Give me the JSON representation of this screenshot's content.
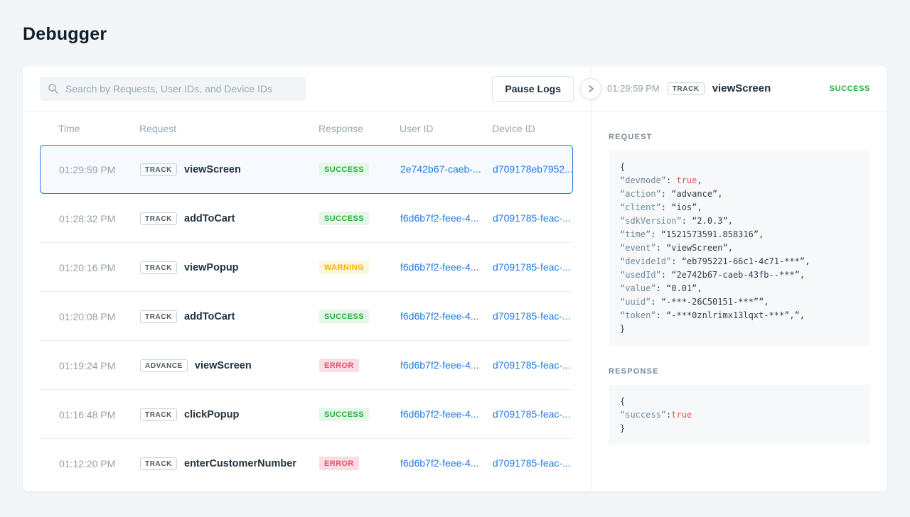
{
  "page": {
    "title": "Debugger"
  },
  "toolbar": {
    "search_placeholder": "Search by Requests, User IDs, and Device IDs",
    "pause_logs_label": "Pause Logs"
  },
  "table": {
    "columns": {
      "time": "Time",
      "request": "Request",
      "response": "Response",
      "user_id": "User ID",
      "device_id": "Device ID"
    },
    "rows": [
      {
        "time": "01:29:59 PM",
        "type": "TRACK",
        "request": "viewScreen",
        "response": "SUCCESS",
        "user_id": "2e742b67-caeb-...",
        "device_id": "d709178eb7952...",
        "selected": true
      },
      {
        "time": "01:28:32 PM",
        "type": "TRACK",
        "request": "addToCart",
        "response": "SUCCESS",
        "user_id": "f6d6b7f2-feee-4...",
        "device_id": "d7091785-feac-...",
        "selected": false
      },
      {
        "time": "01:20:16 PM",
        "type": "TRACK",
        "request": "viewPopup",
        "response": "WARNING",
        "user_id": "f6d6b7f2-feee-4...",
        "device_id": "d7091785-feac-...",
        "selected": false
      },
      {
        "time": "01:20:08 PM",
        "type": "TRACK",
        "request": "addToCart",
        "response": "SUCCESS",
        "user_id": "f6d6b7f2-feee-4...",
        "device_id": "d7091785-feac-...",
        "selected": false
      },
      {
        "time": "01:19:24 PM",
        "type": "ADVANCE",
        "request": "viewScreen",
        "response": "ERROR",
        "user_id": "f6d6b7f2-feee-4...",
        "device_id": "d7091785-feac-...",
        "selected": false
      },
      {
        "time": "01:16:48 PM",
        "type": "TRACK",
        "request": "clickPopup",
        "response": "SUCCESS",
        "user_id": "f6d6b7f2-feee-4...",
        "device_id": "d7091785-feac-...",
        "selected": false
      },
      {
        "time": "01:12:20 PM",
        "type": "TRACK",
        "request": "enterCustomerNumber",
        "response": "ERROR",
        "user_id": "f6d6b7f2-feee-4...",
        "device_id": "d7091785-feac-...",
        "selected": false
      }
    ]
  },
  "detail": {
    "time": "01:29:59 PM",
    "type_badge": "TRACK",
    "event": "viewScreen",
    "status": "SUCCESS",
    "request": {
      "label": "REQUEST",
      "lines": [
        [
          {
            "c": "plain",
            "t": "{"
          }
        ],
        [
          {
            "c": "key",
            "t": "“devmode”"
          },
          {
            "c": "plain",
            "t": ": "
          },
          {
            "c": "bool",
            "t": "true"
          },
          {
            "c": "plain",
            "t": ","
          }
        ],
        [
          {
            "c": "key",
            "t": "“action”"
          },
          {
            "c": "plain",
            "t": ": "
          },
          {
            "c": "str",
            "t": "“advance”"
          },
          {
            "c": "plain",
            "t": ","
          }
        ],
        [
          {
            "c": "key",
            "t": "“client”"
          },
          {
            "c": "plain",
            "t": ": "
          },
          {
            "c": "str",
            "t": "“ios”"
          },
          {
            "c": "plain",
            "t": ","
          }
        ],
        [
          {
            "c": "key",
            "t": "“sdkVersion”"
          },
          {
            "c": "plain",
            "t": ": "
          },
          {
            "c": "str",
            "t": "“2.0.3”"
          },
          {
            "c": "plain",
            "t": ","
          }
        ],
        [
          {
            "c": "key",
            "t": "“time”"
          },
          {
            "c": "plain",
            "t": ": "
          },
          {
            "c": "str",
            "t": "“1521573591.858316”"
          },
          {
            "c": "plain",
            "t": ","
          }
        ],
        [
          {
            "c": "key",
            "t": "“event”"
          },
          {
            "c": "plain",
            "t": ": "
          },
          {
            "c": "str",
            "t": "“viewScreen”"
          },
          {
            "c": "plain",
            "t": ","
          }
        ],
        [
          {
            "c": "key",
            "t": "“devideId”"
          },
          {
            "c": "plain",
            "t": ": "
          },
          {
            "c": "str",
            "t": "“eb795221-66c1-4c71-***”"
          },
          {
            "c": "plain",
            "t": ","
          }
        ],
        [
          {
            "c": "key",
            "t": "“usedId”"
          },
          {
            "c": "plain",
            "t": ": "
          },
          {
            "c": "str",
            "t": "“2e742b67-caeb-43fb--***”"
          },
          {
            "c": "plain",
            "t": ","
          }
        ],
        [
          {
            "c": "key",
            "t": "“value”"
          },
          {
            "c": "plain",
            "t": ": "
          },
          {
            "c": "str",
            "t": "“0.01”"
          },
          {
            "c": "plain",
            "t": ","
          }
        ],
        [
          {
            "c": "key",
            "t": "“uuid”"
          },
          {
            "c": "plain",
            "t": ": "
          },
          {
            "c": "str",
            "t": "“-***-26C50151-***””"
          },
          {
            "c": "plain",
            "t": ","
          }
        ],
        [
          {
            "c": "key",
            "t": "“token”"
          },
          {
            "c": "plain",
            "t": ": "
          },
          {
            "c": "str",
            "t": "“-***0znlrimx13lqxt-***”,”"
          },
          {
            "c": "plain",
            "t": ","
          }
        ],
        [
          {
            "c": "plain",
            "t": "}"
          }
        ]
      ]
    },
    "response": {
      "label": "RESPONSE",
      "lines": [
        [
          {
            "c": "plain",
            "t": "{"
          }
        ],
        [
          {
            "c": "key",
            "t": "“success”"
          },
          {
            "c": "plain",
            "t": ":"
          },
          {
            "c": "bool",
            "t": "true"
          }
        ],
        [
          {
            "c": "plain",
            "t": "}"
          }
        ]
      ]
    }
  },
  "colors": {
    "accent_blue": "#2c7be5",
    "link_blue": "#2079ea",
    "success_green": "#23b33c",
    "success_bg": "#e4f7e8",
    "warning_yellow": "#f0b400",
    "warning_bg": "#fcf6dc",
    "error_red": "#e4536b",
    "error_bg": "#fbdde4",
    "code_key": "#6f8a9d",
    "code_value": "#31404d",
    "code_bool": "#e0584e"
  }
}
